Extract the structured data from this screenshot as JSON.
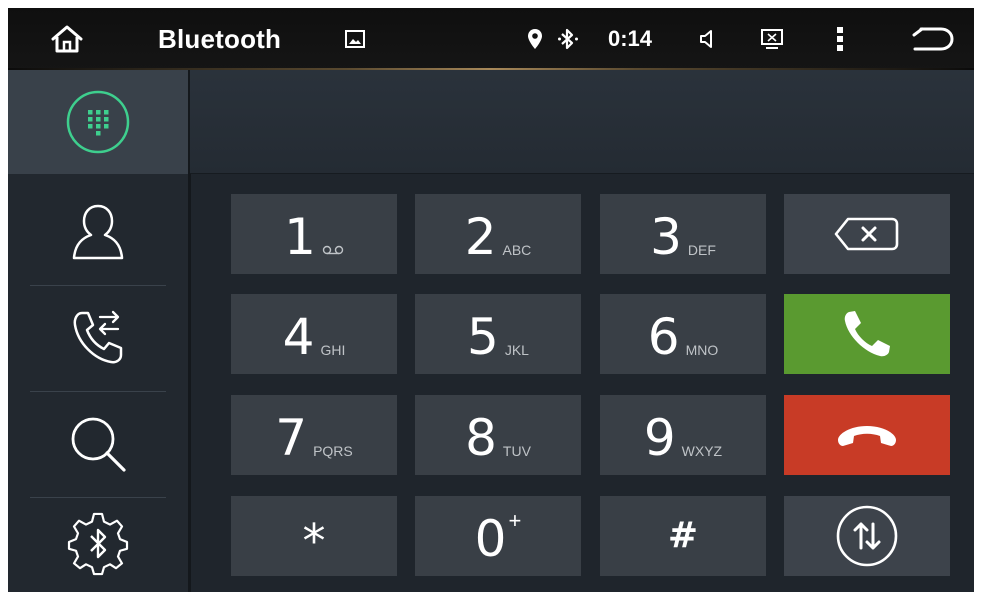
{
  "statusbar": {
    "title": "Bluetooth",
    "time": "0:14",
    "icons": [
      "home-icon",
      "gallery-icon",
      "location-pin-icon",
      "bluetooth-icon",
      "volume-icon",
      "screen-close-icon",
      "more-vert-icon",
      "back-icon"
    ]
  },
  "sidebar": {
    "items": [
      {
        "name": "dialpad",
        "icon": "dialpad-icon",
        "active": true
      },
      {
        "name": "contacts",
        "icon": "contact-icon",
        "active": false
      },
      {
        "name": "call-log",
        "icon": "call-log-icon",
        "active": false
      },
      {
        "name": "search",
        "icon": "search-icon",
        "active": false
      },
      {
        "name": "bt-settings",
        "icon": "bluetooth-settings-icon",
        "active": false
      }
    ]
  },
  "display": {
    "number": ""
  },
  "keypad": {
    "keys": [
      {
        "digit": "1",
        "sub": "ᴏᴏ",
        "icon": "voicemail-icon"
      },
      {
        "digit": "2",
        "sub": "ABC"
      },
      {
        "digit": "3",
        "sub": "DEF"
      },
      {
        "digit": "4",
        "sub": "GHI"
      },
      {
        "digit": "5",
        "sub": "JKL"
      },
      {
        "digit": "6",
        "sub": "MNO"
      },
      {
        "digit": "7",
        "sub": "PQRS"
      },
      {
        "digit": "8",
        "sub": "TUV"
      },
      {
        "digit": "9",
        "sub": "WXYZ"
      },
      {
        "digit": "*",
        "sub": ""
      },
      {
        "digit": "0",
        "sub": "+"
      },
      {
        "digit": "#",
        "sub": ""
      }
    ],
    "actions": [
      "backspace",
      "call",
      "hang-up",
      "transfer"
    ]
  },
  "colors": {
    "accent": "#3ecf8e",
    "call": "#5a9a30",
    "hangup": "#c83b26",
    "key": "#393f46",
    "background": "#1f252c"
  }
}
